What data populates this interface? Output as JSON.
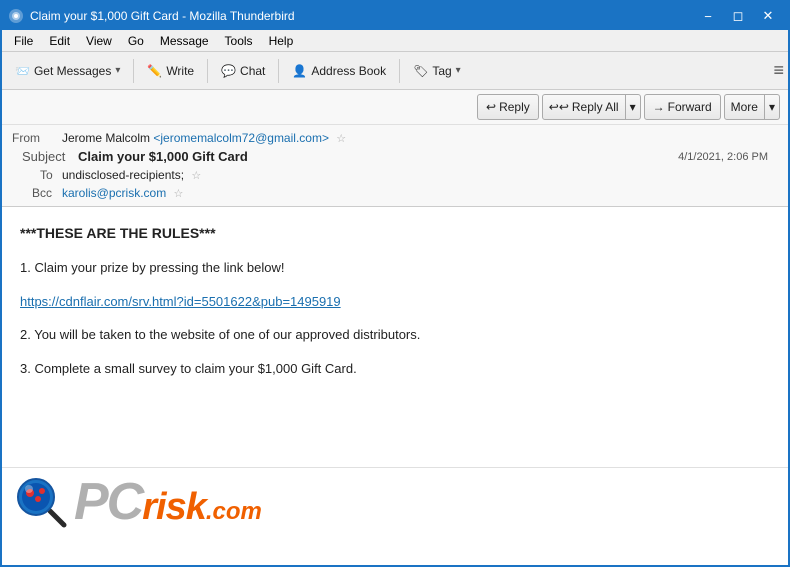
{
  "titleBar": {
    "title": "Claim your $1,000 Gift Card - Mozilla Thunderbird",
    "icon": "🦅"
  },
  "menuBar": {
    "items": [
      "File",
      "Edit",
      "View",
      "Go",
      "Message",
      "Tools",
      "Help"
    ]
  },
  "toolbar": {
    "getMessages": "Get Messages",
    "write": "Write",
    "chat": "Chat",
    "addressBook": "Address Book",
    "tag": "Tag",
    "menuIcon": "≡"
  },
  "emailActions": {
    "reply": "Reply",
    "replyAll": "Reply All",
    "forward": "Forward",
    "more": "More"
  },
  "emailHeader": {
    "fromLabel": "From",
    "fromName": "Jerome Malcolm",
    "fromEmail": "<jeromemalcolm72@gmail.com>",
    "subjectLabel": "Subject",
    "subject": "Claim your $1,000 Gift Card",
    "toLabel": "To",
    "toValue": "undisclosed-recipients;",
    "bccLabel": "Bcc",
    "bccValue": "karolis@pcrisk.com",
    "date": "4/1/2021, 2:06 PM"
  },
  "emailBody": {
    "rules": "***THESE ARE THE RULES***",
    "step1": "1. Claim your prize by pressing the link below!",
    "link": "https://cdnflair.com/srv.html?id=5501622&pub=1495919",
    "step2": "2. You will be taken to the website of one of our approved distributors.",
    "step3": "3. Complete a small survey to claim your $1,000 Gift Card."
  },
  "logo": {
    "pc": "PC",
    "risk": "risk",
    "dotcom": ".com"
  }
}
